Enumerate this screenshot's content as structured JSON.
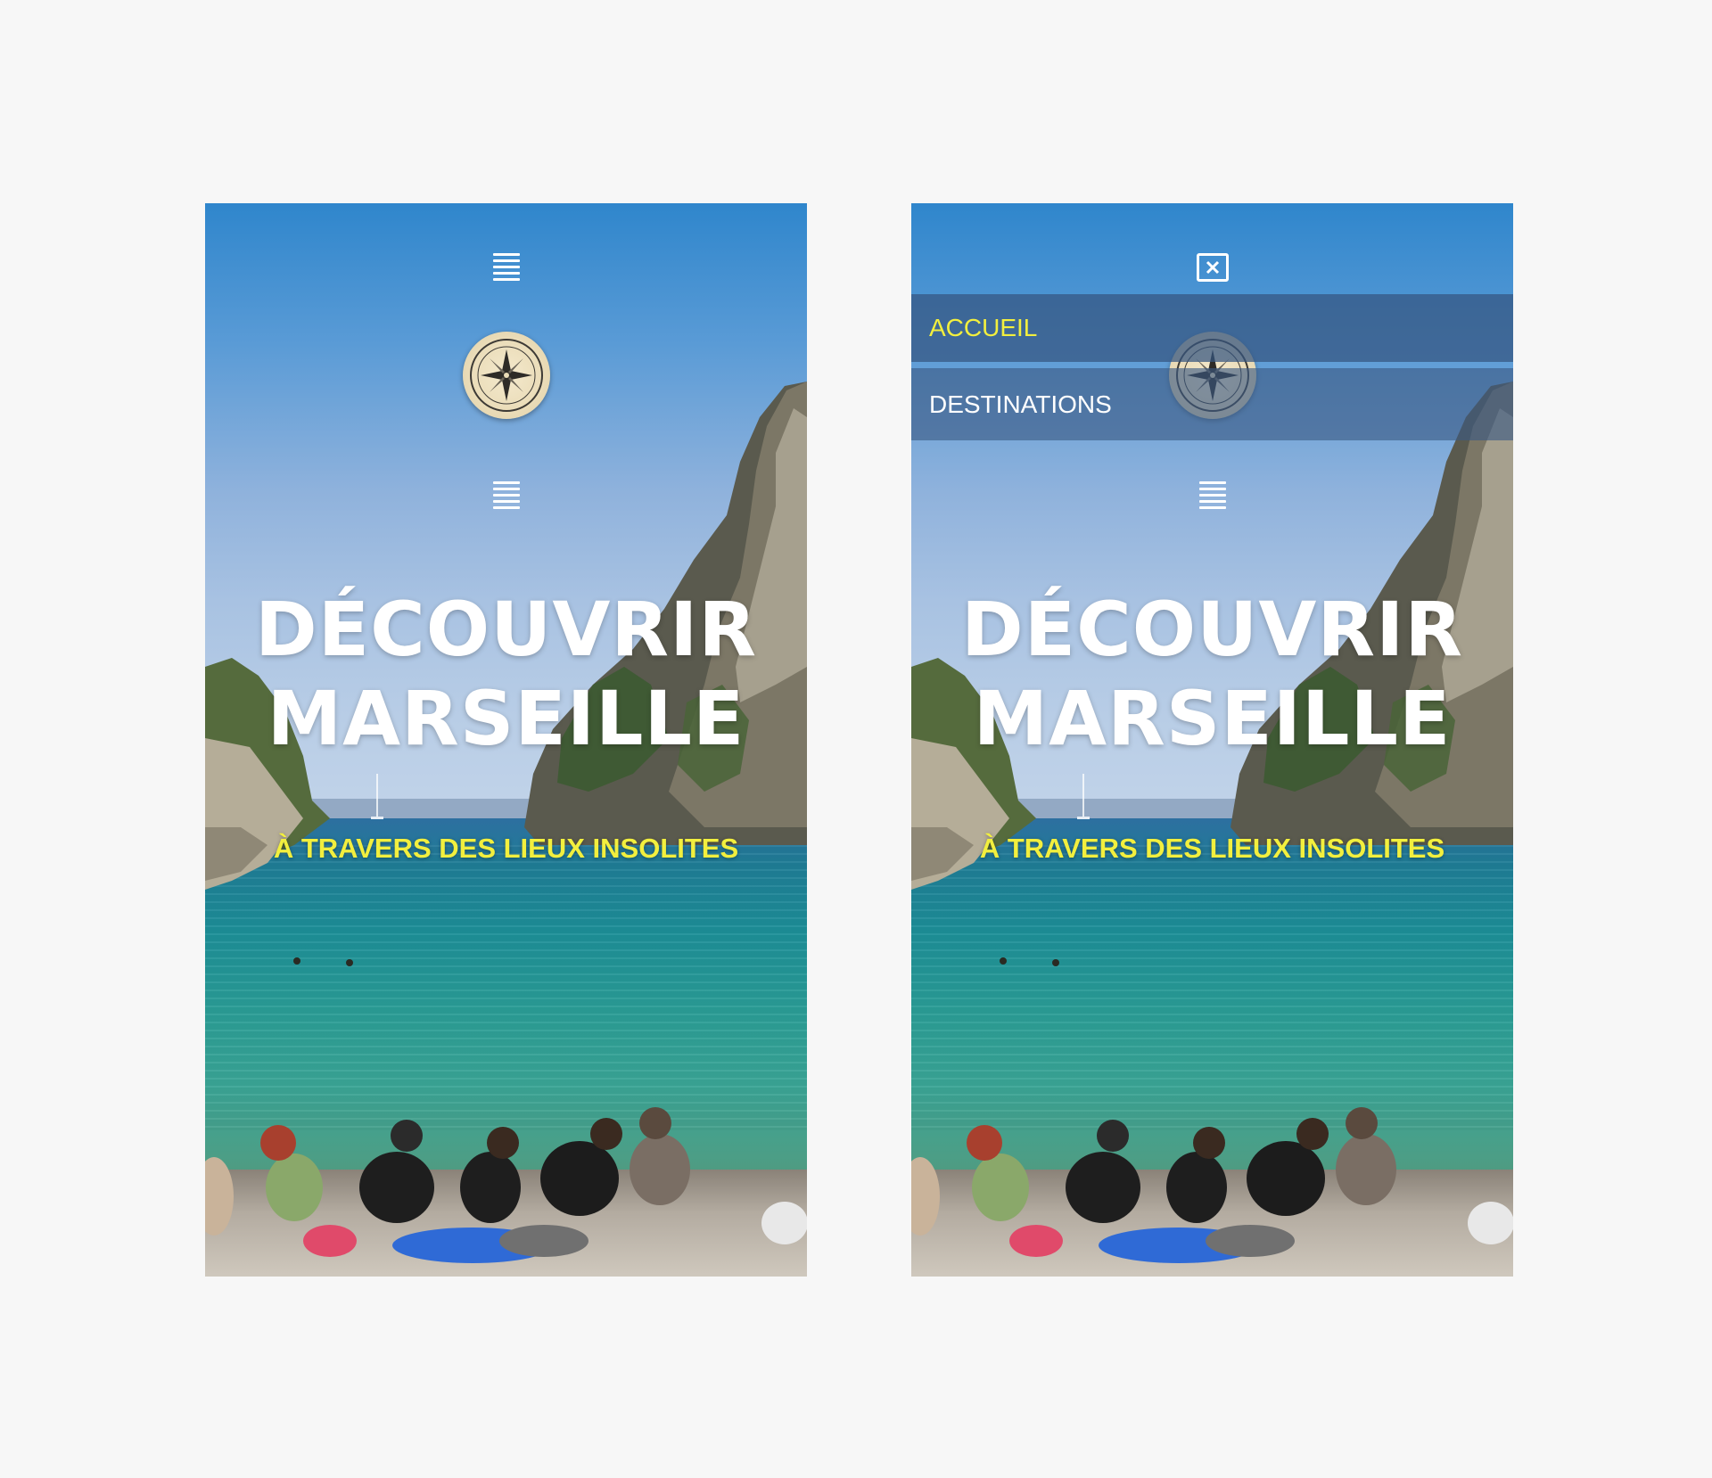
{
  "hero": {
    "title_line1": "DÉCOUVRIR",
    "title_line2": "MARSEILLE",
    "subtitle": "À TRAVERS DES LIEUX INSOLITES"
  },
  "nav": {
    "menu_items": [
      "ACCUEIL",
      "DESTINATIONS"
    ],
    "active_item": "ACCUEIL"
  },
  "icons": {
    "menu": "hamburger-icon",
    "close": "close-icon",
    "logo": "compass-rose-logo"
  },
  "colors": {
    "accent": "#f2ef3e",
    "title": "#ffffff",
    "menu_bg": "#355580",
    "page_bg": "#f7f7f7"
  }
}
